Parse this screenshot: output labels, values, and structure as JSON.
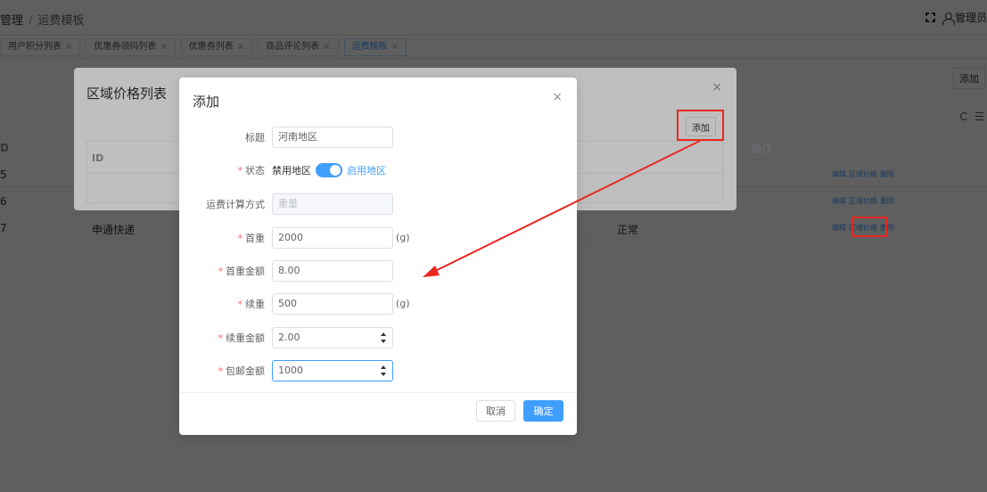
{
  "header": {
    "breadcrumb_parent": "管理",
    "breadcrumb_sep": "/",
    "breadcrumb_current": "运费模板",
    "user_label": "管理员"
  },
  "tags": [
    {
      "label": "用户积分列表",
      "close": "×"
    },
    {
      "label": "优惠券领码列表",
      "close": "×"
    },
    {
      "label": "优惠券列表",
      "close": "×"
    },
    {
      "label": "商品评论列表",
      "close": "×"
    },
    {
      "label": "运费模板",
      "close": "×"
    }
  ],
  "page": {
    "add_label": "添加",
    "rows": [
      {
        "id": "5",
        "name": "",
        "status": "",
        "actions": [
          "编辑",
          "区域价格",
          "删除"
        ]
      },
      {
        "id": "6",
        "name": "",
        "status": "",
        "actions": [
          "编辑",
          "区域价格",
          "删除"
        ]
      },
      {
        "id": "7",
        "name": "申通快递",
        "status": "正常",
        "actions": [
          "编辑",
          "区域价格",
          "删除"
        ]
      }
    ],
    "id_header": "D"
  },
  "region_dialog": {
    "title": "区域价格列表",
    "close": "×",
    "add_label": "添加",
    "id_header": "ID",
    "ops_header": "操作"
  },
  "add_dialog": {
    "title": "添加",
    "close": "×",
    "fields": {
      "title": {
        "label": "标题",
        "value": "河南地区",
        "required": false
      },
      "status": {
        "label": "状态",
        "off_text": "禁用地区",
        "on_text": "启用地区",
        "checked": true,
        "required": true
      },
      "calc_method": {
        "label": "运费计算方式",
        "value": "重量",
        "required": false
      },
      "first_weight": {
        "label": "首重",
        "value": "2000",
        "unit": "(g)",
        "required": true
      },
      "first_amount": {
        "label": "首重金额",
        "value": "8.00",
        "required": true
      },
      "next_weight": {
        "label": "续重",
        "value": "500",
        "unit": "(g)",
        "required": true
      },
      "next_amount": {
        "label": "续重金额",
        "value": "2.00",
        "required": true
      },
      "free_amount": {
        "label": "包邮金额",
        "value": "1000",
        "required": true
      }
    },
    "star": "*",
    "cancel_label": "取消",
    "ok_label": "确定"
  },
  "colors": {
    "primary": "#409eff",
    "annotation": "#e8281e"
  }
}
